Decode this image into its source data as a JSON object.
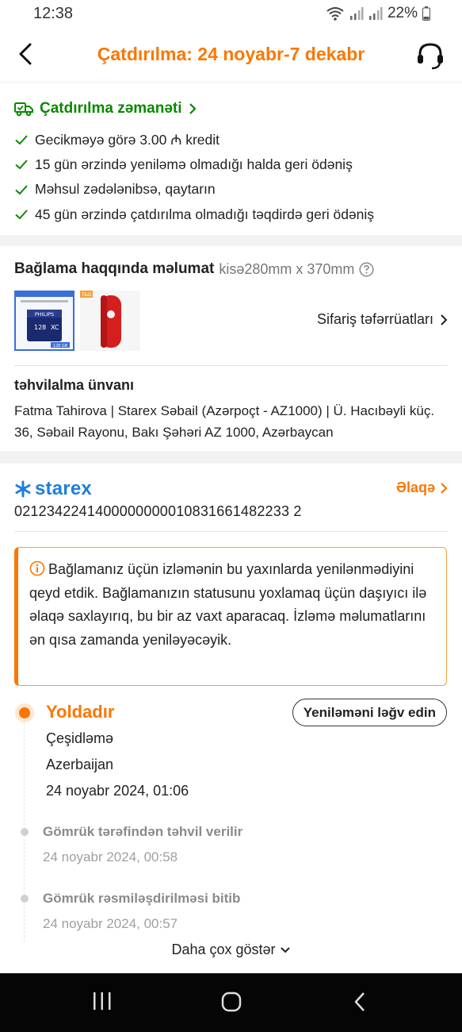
{
  "status_bar": {
    "time": "12:38",
    "battery": "22%"
  },
  "header": {
    "title": "Çatdırılma: 24 noyabr-7 dekabr"
  },
  "guarantee": {
    "title": "Çatdırılma zəmanəti",
    "items": [
      "Gecikməyə görə 3.00 ₼ kredit",
      "15 gün ərzində yeniləmə olmadığı halda geri ödəniş",
      "Məhsul zədələnibsə, qaytarın",
      "45 gün ərzində çatdırılma olmadığı təqdirdə geri ödəniş"
    ],
    "accent_color": "#0a8800"
  },
  "package": {
    "heading": "Bağlama haqqında məlumat",
    "size": "kisə280mm x 370mm",
    "order_details": "Sifariş təfərrüatları",
    "thumbnail_texts": [
      "PHILIPS",
      "128 GB",
      "T&G"
    ],
    "address_title": "təhvilalma ünvanı",
    "address": "Fatma Tahirova  |  Starex Səbail (Azərpoçt - AZ1000)  |  Ü. Hacıbəyli küç. 36, Səbail Rayonu, Bakı Şəhəri AZ 1000, Azərbaycan"
  },
  "carrier": {
    "name": "starex",
    "contact": "Əlaqə",
    "tracking_number": "0212342241400000000010831661482233 2"
  },
  "notice": {
    "text": "Bağlamanız üçün izləmənin bu yaxınlarda yenilənmədiyini qeyd etdik. Bağlamanızın statusunu yoxlamaq üçün daşıyıcı ilə əlaqə saxlayırıq, bu bir az vaxt aparacaq. İzləmə məlumatlarını ən qısa zamanda yeniləyəcəyik."
  },
  "tracking": {
    "current_status": "Yoldadır",
    "cancel_button": "Yeniləməni ləğv edin",
    "current_lines": [
      "Çeşidləmə",
      "Azerbaijan",
      "24 noyabr 2024, 01:06"
    ],
    "events": [
      {
        "title": "Gömrük tərəfindən təhvil verilir",
        "time": "24 noyabr 2024, 00:58"
      },
      {
        "title": "Gömrük rəsmiləşdirilməsi bitib",
        "time": "24 noyabr 2024, 00:57"
      }
    ],
    "show_more": "Daha çox göstər"
  },
  "colors": {
    "accent": "#fb7701",
    "starex_blue": "#1e7fd9",
    "nav_bar": "#050505"
  }
}
